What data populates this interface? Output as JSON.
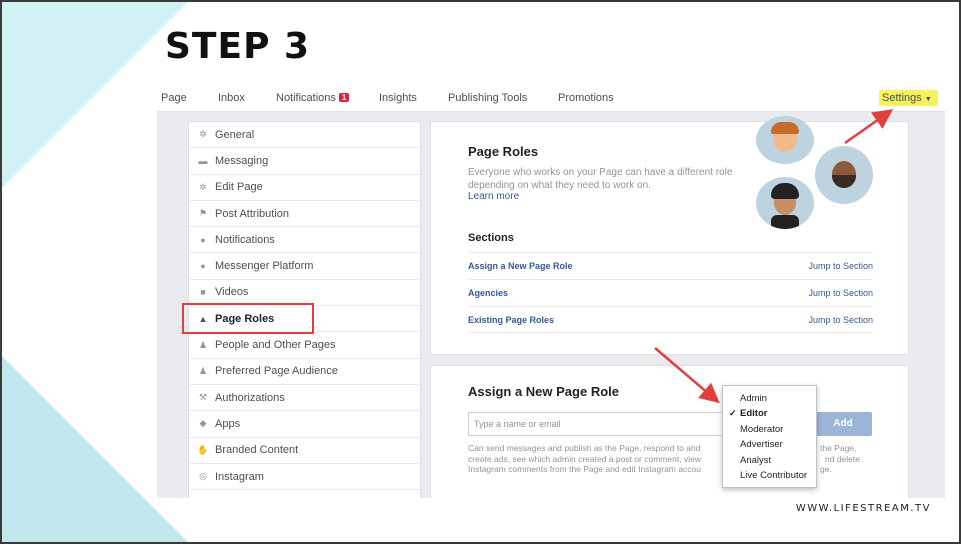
{
  "slide": {
    "title": "STEP 3",
    "footer": "WWW.LIFESTREAM.TV",
    "accent_color": "#e0413f",
    "highlight_color": "#f4f45a"
  },
  "topnav": {
    "items": [
      {
        "label": "Page"
      },
      {
        "label": "Inbox"
      },
      {
        "label": "Notifications",
        "badge": "1"
      },
      {
        "label": "Insights"
      },
      {
        "label": "Publishing Tools"
      },
      {
        "label": "Promotions"
      }
    ],
    "settings_label": "Settings"
  },
  "sidebar": {
    "items": [
      {
        "label": "General",
        "icon": "gear-icon"
      },
      {
        "label": "Messaging",
        "icon": "chat-icon"
      },
      {
        "label": "Edit Page",
        "icon": "gear-icon"
      },
      {
        "label": "Post Attribution",
        "icon": "flag-icon"
      },
      {
        "label": "Notifications",
        "icon": "globe-icon"
      },
      {
        "label": "Messenger Platform",
        "icon": "messenger-icon"
      },
      {
        "label": "Videos",
        "icon": "video-icon"
      },
      {
        "label": "Page Roles",
        "icon": "person-icon",
        "active": true
      },
      {
        "label": "People and Other Pages",
        "icon": "people-icon"
      },
      {
        "label": "Preferred Page Audience",
        "icon": "people-icon"
      },
      {
        "label": "Authorizations",
        "icon": "wrench-icon"
      },
      {
        "label": "Apps",
        "icon": "cube-icon"
      },
      {
        "label": "Branded Content",
        "icon": "handshake-icon"
      },
      {
        "label": "Instagram",
        "icon": "instagram-icon"
      }
    ]
  },
  "page_roles": {
    "title": "Page Roles",
    "description": "Everyone who works on your Page can have a different role depending on what they need to work on.",
    "learn_more": "Learn more",
    "sections_title": "Sections",
    "sections": [
      {
        "label": "Assign a New Page Role",
        "jump": "Jump to Section"
      },
      {
        "label": "Agencies",
        "jump": "Jump to Section"
      },
      {
        "label": "Existing Page Roles",
        "jump": "Jump to Section"
      }
    ]
  },
  "assign": {
    "title": "Assign a New Page Role",
    "input_placeholder": "Type a name or email",
    "add_label": "Add",
    "help_lines": [
      "Can send messages and publish as the Page, respond to and",
      "create ads, see which admin created a post or comment, view",
      "Instagram comments from the Page and edit Instagram accou"
    ],
    "help_tail": [
      "the Page,",
      "nd delete",
      "ge."
    ]
  },
  "role_dropdown": {
    "options": [
      "Admin",
      "Editor",
      "Moderator",
      "Advertiser",
      "Analyst",
      "Live Contributor"
    ],
    "selected": "Editor"
  }
}
